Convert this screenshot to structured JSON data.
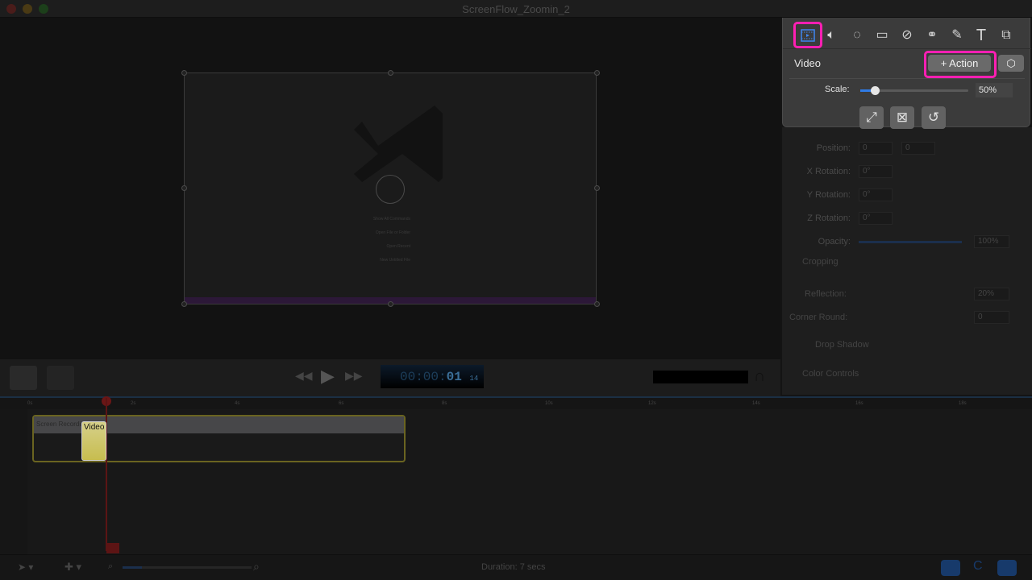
{
  "window": {
    "title": "ScreenFlow_Zoomin_2"
  },
  "canvas": {
    "welcome_items": [
      "Show All Commands",
      "Open File or Folder",
      "Open Recent",
      "New Untitled File"
    ]
  },
  "transport": {
    "timecode_dim": "00:00:",
    "timecode_sec": "01",
    "timecode_frames": "14"
  },
  "inspector_panel": {
    "tabs": [
      {
        "icon": "video-properties-icon",
        "active": true
      },
      {
        "icon": "audio-icon"
      },
      {
        "icon": "video-motion-icon"
      },
      {
        "icon": "screen-recording-icon"
      },
      {
        "icon": "callout-icon"
      },
      {
        "icon": "annotations-icon"
      },
      {
        "icon": "pen-icon"
      },
      {
        "icon": "text-icon"
      },
      {
        "icon": "media-library-icon"
      }
    ],
    "section_title": "Video",
    "action_button": "+ Action",
    "scale_label": "Scale:",
    "scale_value": "50%",
    "scale_percent": 50,
    "highlight_color": "#ff1fb3",
    "accent_color": "#2f7be6"
  },
  "inspector": {
    "position_label": "Position:",
    "position_x": "0",
    "position_y": "0",
    "x_rotation_label": "X Rotation:",
    "x_rotation": "0°",
    "y_rotation_label": "Y Rotation:",
    "y_rotation": "0°",
    "z_rotation_label": "Z Rotation:",
    "z_rotation": "0°",
    "opacity_label": "Opacity:",
    "opacity_value": "100%",
    "cropping": "Cropping",
    "reflection_label": "Reflection:",
    "reflection_value": "20%",
    "corner_round_label": "Corner Round:",
    "corner_round_value": "0",
    "drop_shadow": "Drop Shadow",
    "color_controls": "Color Controls"
  },
  "timeline": {
    "ruler": [
      "0s",
      "2s",
      "4s",
      "6s",
      "8s",
      "10s",
      "12s",
      "14s",
      "16s",
      "18s"
    ],
    "clip_title": "Screen Recording 07/20",
    "tooltip": "Video"
  },
  "footer": {
    "duration": "Duration: 7 secs"
  }
}
